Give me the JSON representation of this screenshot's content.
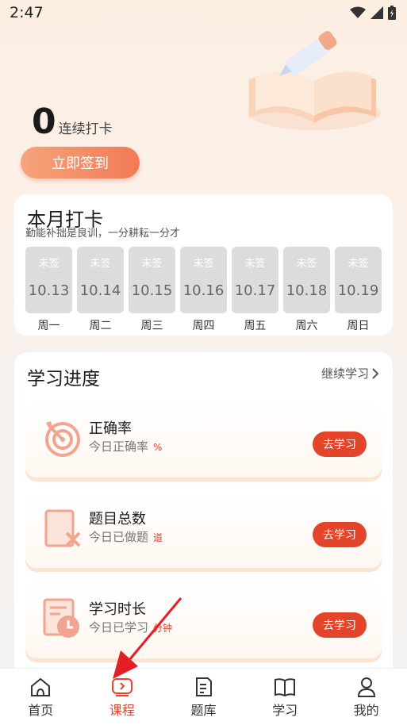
{
  "status_bar": {
    "time": "2:47"
  },
  "streak": {
    "count": "0",
    "label": "连续打卡"
  },
  "signin_button": "立即签到",
  "month": {
    "title": "本月打卡",
    "subtitle": "勤能补拙是良训，一分耕耘一分才",
    "days": [
      {
        "status": "未签",
        "date": "10.13",
        "weekday": "周一"
      },
      {
        "status": "未签",
        "date": "10.14",
        "weekday": "周二"
      },
      {
        "status": "未签",
        "date": "10.15",
        "weekday": "周三"
      },
      {
        "status": "未签",
        "date": "10.16",
        "weekday": "周四"
      },
      {
        "status": "未签",
        "date": "10.17",
        "weekday": "周五"
      },
      {
        "status": "未签",
        "date": "10.18",
        "weekday": "周六"
      },
      {
        "status": "未签",
        "date": "10.19",
        "weekday": "周日"
      }
    ]
  },
  "progress": {
    "title": "学习进度",
    "continue_label": "继续学习",
    "items": [
      {
        "title": "正确率",
        "subtitle": "今日正确率",
        "unit": "%",
        "button": "去学习",
        "icon": "target-icon"
      },
      {
        "title": "题目总数",
        "subtitle": "今日已做题",
        "unit": "道",
        "button": "去学习",
        "icon": "question-sheet-icon"
      },
      {
        "title": "学习时长",
        "subtitle": "今日已学习",
        "unit": "分钟",
        "button": "去学习",
        "icon": "clock-document-icon"
      }
    ]
  },
  "tabs": [
    {
      "label": "首页",
      "icon": "home-icon",
      "active": false
    },
    {
      "label": "课程",
      "icon": "course-play-icon",
      "active": true
    },
    {
      "label": "题库",
      "icon": "document-icon",
      "active": false
    },
    {
      "label": "学习",
      "icon": "book-icon",
      "active": false
    },
    {
      "label": "我的",
      "icon": "person-icon",
      "active": false
    }
  ],
  "colors": {
    "accent": "#e3452a",
    "signin_gradient_start": "#f6a47c",
    "signin_gradient_end": "#f27a55"
  }
}
